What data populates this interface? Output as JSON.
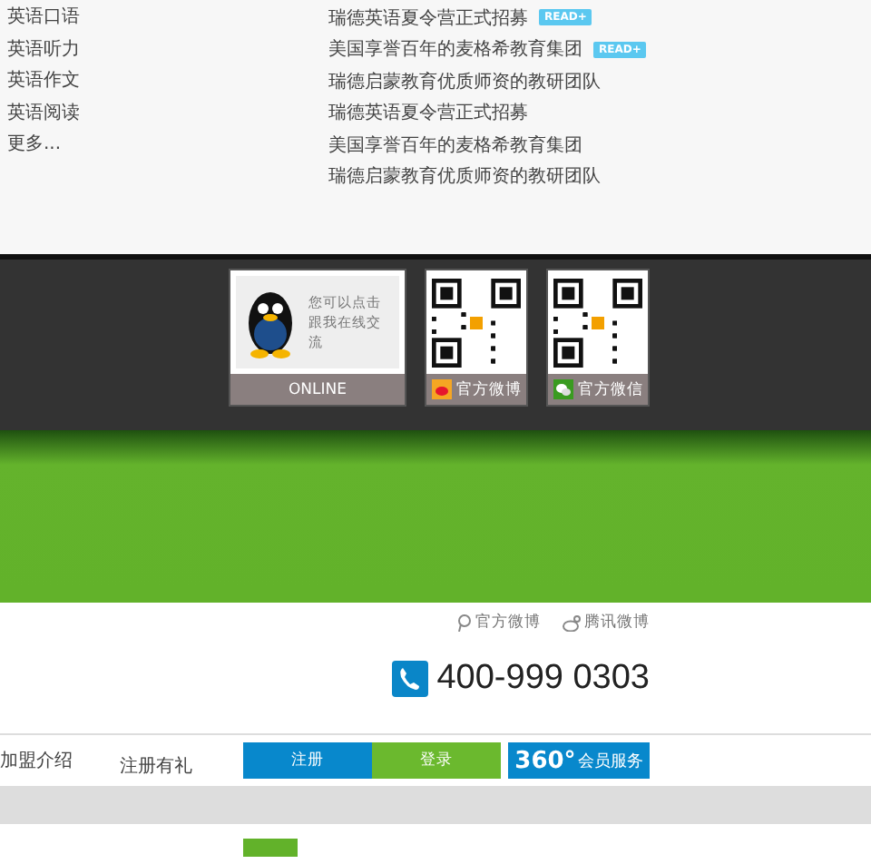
{
  "categories": [
    {
      "label": "英语口语"
    },
    {
      "label": "英语听力"
    },
    {
      "label": "英语作文"
    },
    {
      "label": "英语阅读"
    },
    {
      "label": "更多..."
    }
  ],
  "news": [
    {
      "title": "瑞德英语夏令营正式招募",
      "badge": "READ+"
    },
    {
      "title": "美国享誉百年的麦格希教育集团",
      "badge": "READ+"
    },
    {
      "title": "瑞德启蒙教育优质师资的教研团队"
    },
    {
      "title": "瑞德英语夏令营正式招募"
    },
    {
      "title": "美国享誉百年的麦格希教育集团"
    },
    {
      "title": "瑞德启蒙教育优质师资的教研团队"
    }
  ],
  "contact_cards": [
    {
      "kind": "qq",
      "text": "您可以点击跟我在线交流",
      "caption": "ONLINE"
    },
    {
      "kind": "weibo",
      "caption": "官方微博"
    },
    {
      "kind": "wechat",
      "caption": "官方微信"
    }
  ],
  "header": {
    "social_links": [
      {
        "kind": "weibo-pin",
        "label": "官方微博"
      },
      {
        "kind": "tencent",
        "label": "腾讯微博"
      }
    ],
    "phone": "400-999 0303"
  },
  "nav": {
    "links": [
      "加盟介绍",
      "注册有礼"
    ],
    "buttons": [
      {
        "kind": "register",
        "label": "注册"
      },
      {
        "kind": "login",
        "label": "登录"
      }
    ],
    "member": {
      "number": "360°",
      "label": "会员服务"
    }
  }
}
